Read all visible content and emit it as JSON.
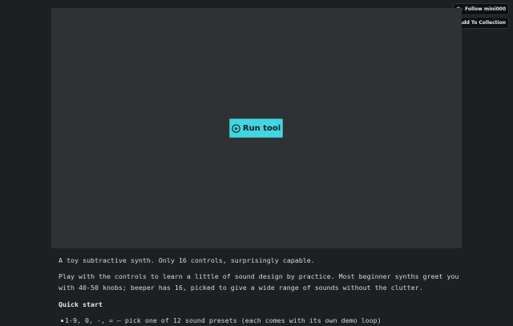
{
  "header": {
    "follow_label": "Follow mini000",
    "collection_label": "Add To Collection",
    "follow_icon": "user-plus-icon",
    "collection_icon": "playlist-add-icon"
  },
  "stage": {
    "run_label": "Run tool",
    "run_icon": "play-circle-icon"
  },
  "description": {
    "intro": "A toy subtractive synth. Only 16 controls, surprisingly capable.",
    "paragraph": "Play with the controls to learn a little of sound design by practice. Most beginner synths greet you with 40-50 knobs; beeper has 16, picked to give a wide range of sounds without the clutter.",
    "quick_start_heading": "Quick start",
    "bullets": [
      "1-9, 0, -, = — pick one of 12 sound presets (each comes with its own demo loop)"
    ]
  },
  "colors": {
    "page_bg": "#1c2022",
    "stage_bg": "#2f3235",
    "accent": "#46d4e0",
    "text": "#d4d8da"
  }
}
